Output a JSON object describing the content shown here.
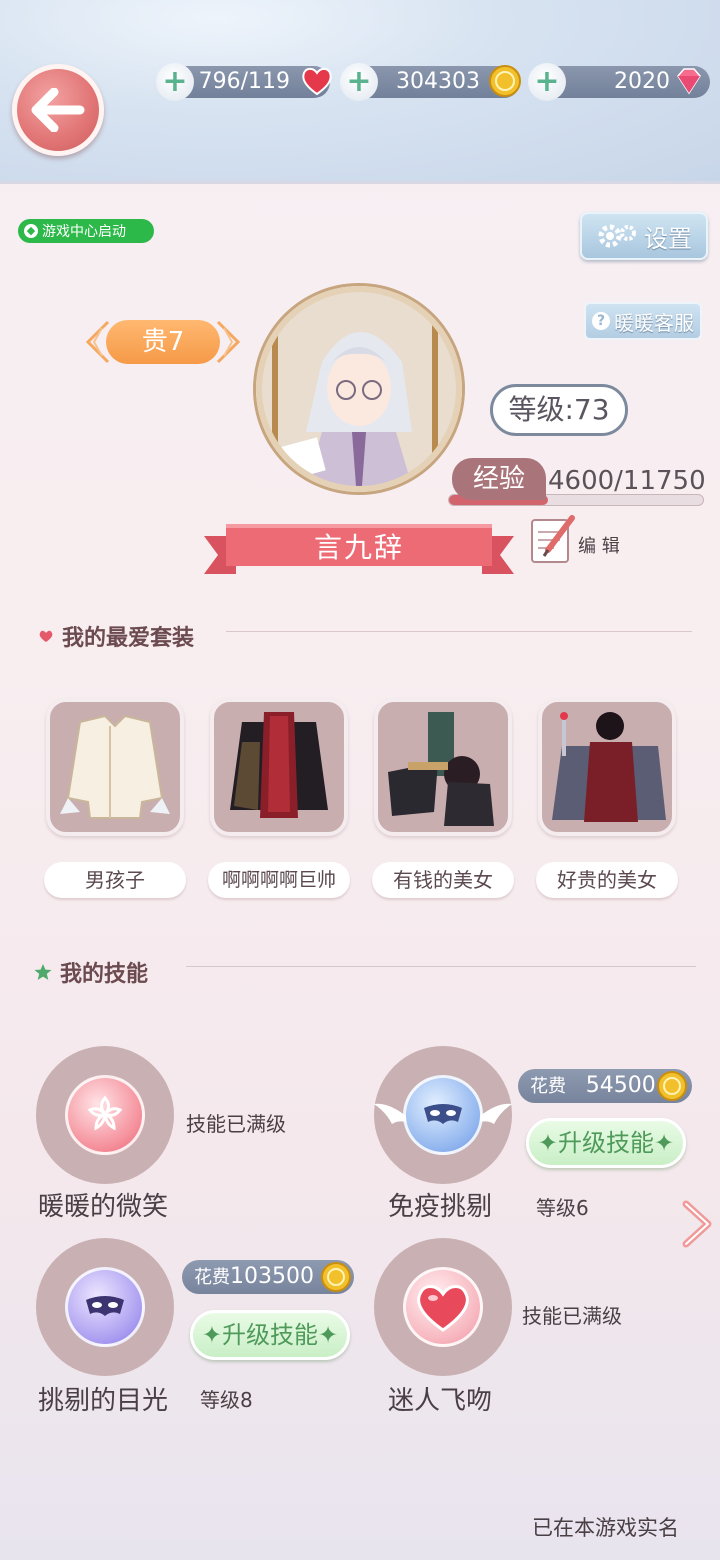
{
  "header": {
    "back_icon": "arrow-left-icon",
    "stamina": "796/119",
    "gold": "304303",
    "diamonds": "2020"
  },
  "game_center_badge": "游戏中心启动",
  "settings_label": "设置",
  "service_label": "暖暖客服",
  "profile": {
    "vip": "贵7",
    "level": "等级:73",
    "exp_label": "经验",
    "exp_value": "4600/11750",
    "exp_fraction": 0.39,
    "name": "言九辞",
    "edit_label": "编 辑"
  },
  "outfits": {
    "title": "我的最爱套装",
    "items": [
      {
        "label": "男孩子"
      },
      {
        "label": "啊啊啊啊巨帅"
      },
      {
        "label": "有钱的美女"
      },
      {
        "label": "好贵的美女"
      }
    ]
  },
  "skills": {
    "title": "我的技能",
    "items": [
      {
        "name": "暖暖的微笑",
        "status": "技能已满级",
        "icon": "sakura-icon"
      },
      {
        "name": "免疫挑剔",
        "cost_label": "花费",
        "cost": "54500",
        "upgrade": "升级技能",
        "level": "等级6",
        "icon": "winged-mask-icon"
      },
      {
        "name": "挑剔的目光",
        "cost_label": "花费",
        "cost": "103500",
        "upgrade": "升级技能",
        "level": "等级8",
        "icon": "mask-icon"
      },
      {
        "name": "迷人飞吻",
        "status": "技能已满级",
        "icon": "heart-icon"
      }
    ]
  },
  "footer": {
    "realname": "已在本游戏实名"
  },
  "colors": {
    "accent_red": "#e8606b",
    "vip_orange": "#f59a48",
    "upgrade_green": "#4f9a5a"
  }
}
